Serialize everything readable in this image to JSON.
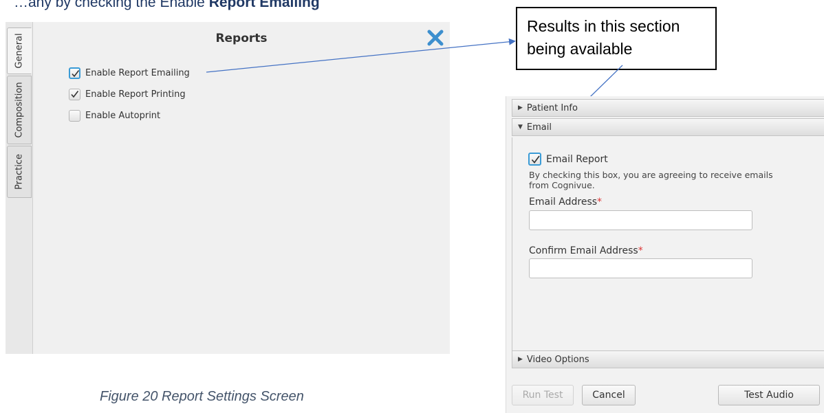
{
  "document": {
    "top_text_plain": "…any by checking the Enable ",
    "top_text_bold": "Report Emailing",
    "caption": "Figure 20 Report Settings Screen",
    "callout": "Results in this section being available"
  },
  "settings_panel": {
    "tabs": [
      "General",
      "Composition",
      "Practice"
    ],
    "active_tab": "General",
    "title": "Reports",
    "options": [
      {
        "label": "Enable Report Emailing",
        "checked": true
      },
      {
        "label": "Enable Report Printing",
        "checked": true
      },
      {
        "label": "Enable Autoprint",
        "checked": false
      }
    ],
    "close_icon": "close-x-icon",
    "accent_color": "#3d8fce"
  },
  "test_dialog": {
    "sections": {
      "patient_info": "Patient Info",
      "email": "Email",
      "video_options": "Video Options"
    },
    "email_report_label": "Email Report",
    "email_report_checked": true,
    "agreement_text": "By checking this box, you are agreeing to receive emails from Cognivue.",
    "email_address_label": "Email Address",
    "confirm_email_label": "Confirm Email Address",
    "required_marker": "*",
    "email_address_value": "",
    "confirm_email_value": "",
    "buttons": {
      "run_test": "Run Test",
      "cancel": "Cancel",
      "test_audio": "Test Audio"
    }
  },
  "colors": {
    "arrow": "#4472c4",
    "required": "#d33333"
  }
}
